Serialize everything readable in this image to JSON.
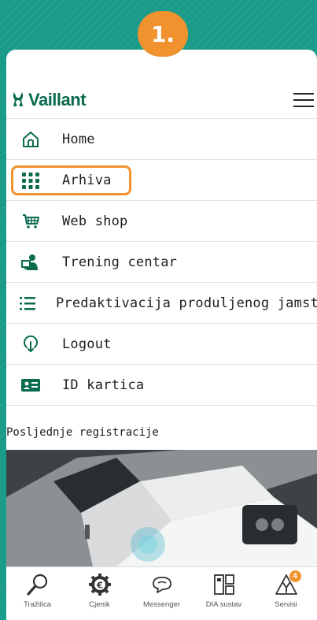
{
  "step_badge": "1.",
  "brand": {
    "name": "Vaillant",
    "color": "#0a6b4f"
  },
  "menu": {
    "items": [
      {
        "label": "Home",
        "icon": "home-icon"
      },
      {
        "label": "Arhiva",
        "icon": "grid-icon",
        "highlighted": true
      },
      {
        "label": "Web shop",
        "icon": "cart-icon"
      },
      {
        "label": "Trening centar",
        "icon": "training-icon"
      },
      {
        "label": "Predaktivacija produljenog jamstva",
        "icon": "list-icon"
      },
      {
        "label": "Logout",
        "icon": "logout-icon"
      },
      {
        "label": "ID kartica",
        "icon": "id-card-icon"
      }
    ]
  },
  "section": {
    "title": "Posljednje registracije"
  },
  "tabbar": {
    "items": [
      {
        "label": "Tražilica",
        "icon": "search-icon"
      },
      {
        "label": "Cjenik",
        "icon": "euro-gear-icon"
      },
      {
        "label": "Messenger",
        "icon": "chat-icon"
      },
      {
        "label": "DIA sustav",
        "icon": "dia-icon"
      },
      {
        "label": "Servisi",
        "icon": "service-icon",
        "badge": "4"
      }
    ]
  },
  "colors": {
    "background": "#1a9b8a",
    "accent": "#f0922e",
    "brand_green": "#0a6b4f"
  }
}
